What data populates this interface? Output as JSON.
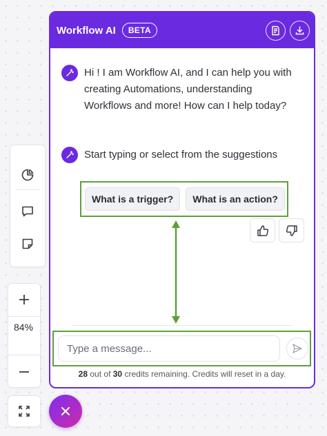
{
  "chat": {
    "title": "Workflow AI",
    "badge": "BETA",
    "messages": [
      {
        "text": "Hi ! I am Workflow AI, and I can help you with creating Automations, understanding Workflows and more! How can I help today?"
      },
      {
        "text": "Start typing or select from the suggestions"
      }
    ],
    "suggestions": [
      "What is a trigger?",
      "What is an action?"
    ],
    "input_placeholder": "Type a message...",
    "credits": {
      "used": "28",
      "out_of": "out of",
      "total": "30",
      "suffix": "credits remaining. Credits will reset in a day."
    }
  },
  "toolbar": {
    "zoom": "84%",
    "icons": [
      "pie-chart-icon",
      "comment-icon",
      "sticky-note-icon",
      "plus-icon",
      "minus-icon",
      "fullscreen-icon"
    ]
  },
  "colors": {
    "brand": "#6a2ae0",
    "highlight": "#5e9f3a",
    "fab_start": "#7b2ff0",
    "fab_end": "#d12aa9"
  }
}
